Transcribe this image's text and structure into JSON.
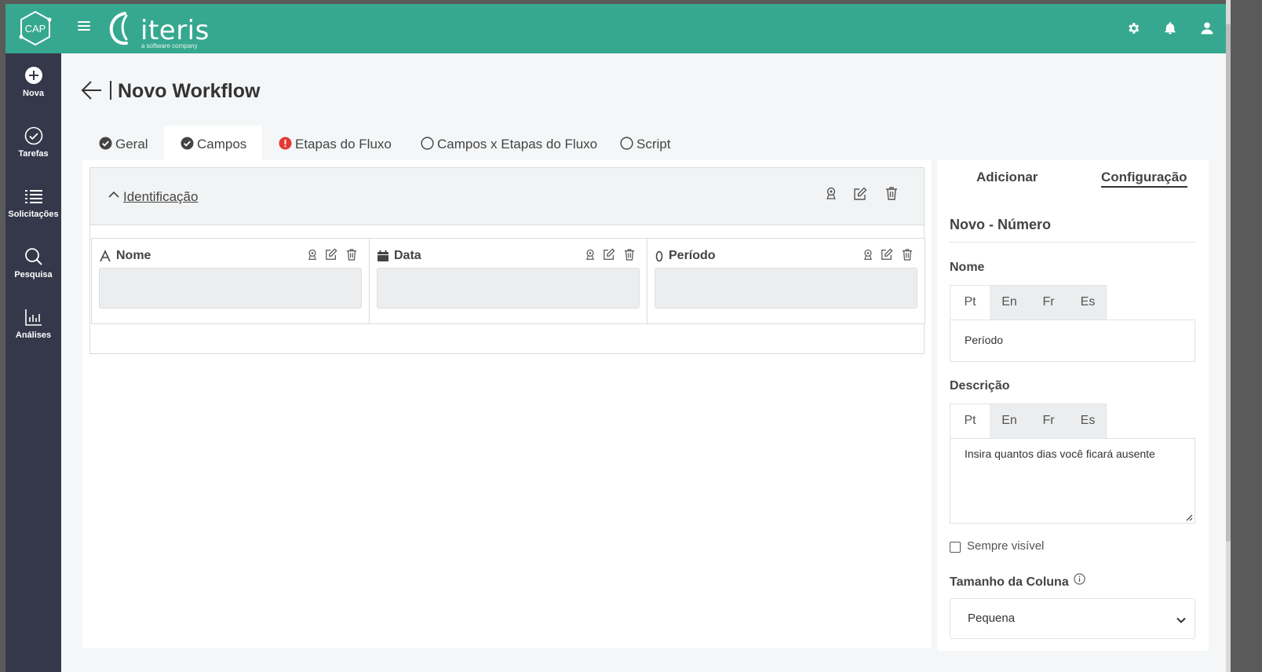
{
  "topbar": {
    "app_logo_text": "CAP",
    "brand_name": "iteris",
    "brand_tagline": "a software company",
    "icons": [
      "gear-icon",
      "bell-icon",
      "user-icon"
    ]
  },
  "sidebar": {
    "items": [
      {
        "label": "Nova",
        "icon": "plus-circle-icon"
      },
      {
        "label": "Tarefas",
        "icon": "check-circle-icon"
      },
      {
        "label": "Solicitações",
        "icon": "list-icon"
      },
      {
        "label": "Pesquisa",
        "icon": "search-icon"
      },
      {
        "label": "Análises",
        "icon": "bar-chart-icon"
      }
    ]
  },
  "page": {
    "title": "Novo Workflow"
  },
  "tabs": [
    {
      "label": "Geral",
      "status": "complete",
      "active": false
    },
    {
      "label": "Campos",
      "status": "complete",
      "active": true
    },
    {
      "label": "Etapas do Fluxo",
      "status": "error",
      "active": false
    },
    {
      "label": "Campos x Etapas do Fluxo",
      "status": "empty",
      "active": false
    },
    {
      "label": "Script",
      "status": "empty",
      "active": false
    }
  ],
  "builder": {
    "section": {
      "title": "Identificação",
      "actions": [
        "permission-icon",
        "edit-icon",
        "trash-icon"
      ]
    },
    "fields": [
      {
        "label": "Nome",
        "type_icon": "text-type-icon"
      },
      {
        "label": "Data",
        "type_icon": "calendar-icon"
      },
      {
        "label": "Período",
        "type_icon": "number-type-icon"
      }
    ]
  },
  "panel": {
    "tabs": [
      "Adicionar",
      "Configuração"
    ],
    "active_tab": "Configuração",
    "subtitle": "Novo - Número",
    "name_label": "Nome",
    "languages": [
      "Pt",
      "En",
      "Fr",
      "Es"
    ],
    "name_value": "Período",
    "description_label": "Descrição",
    "description_value": "Insira quantos dias você ficará ausente",
    "always_visible_label": "Sempre visível",
    "always_visible_checked": false,
    "column_size_label": "Tamanho da Coluna",
    "column_size_value": "Pequena"
  },
  "colors": {
    "topbar": "#36a88f",
    "sidebar": "#35384a",
    "error": "#e53935"
  }
}
